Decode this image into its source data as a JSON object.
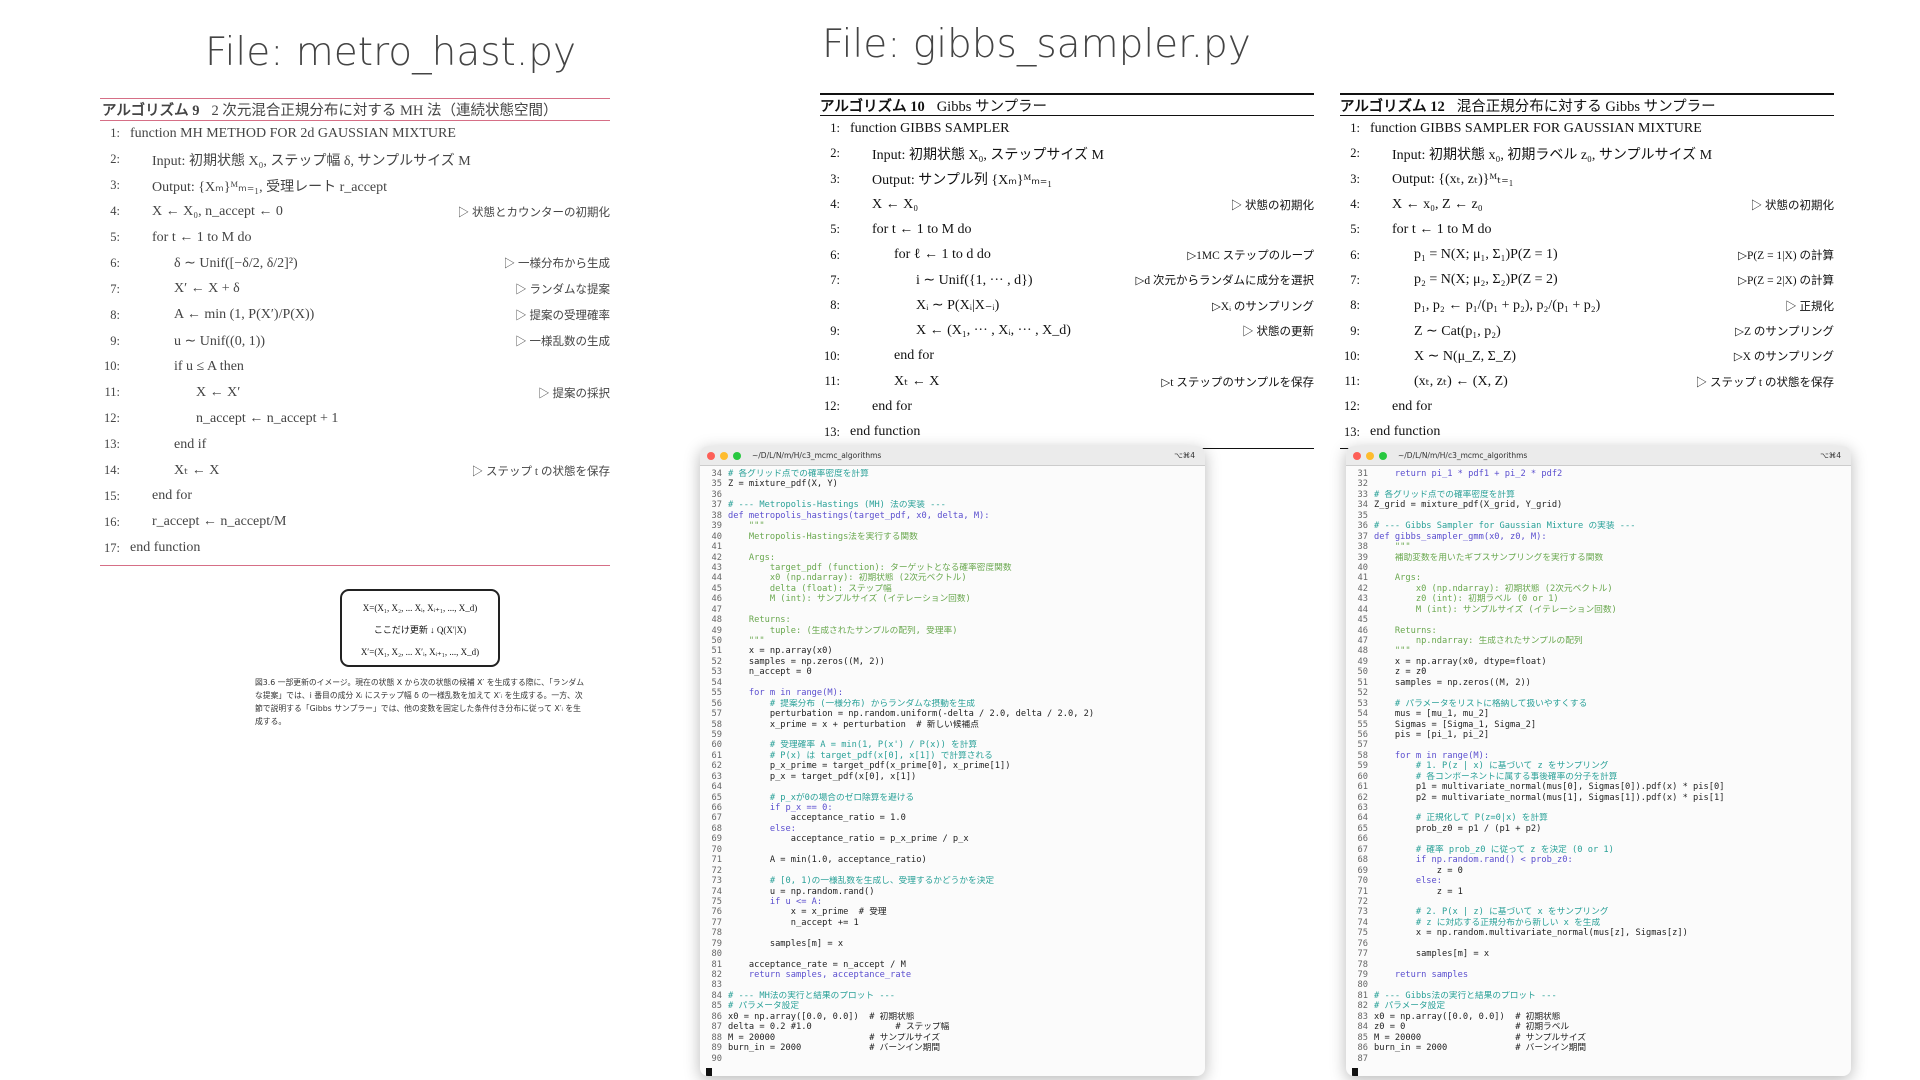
{
  "titles": {
    "left": "File: metro_hast.py",
    "right": "File: gibbs_sampler.py"
  },
  "alg9": {
    "heading": "アルゴリズム 9",
    "title": "2 次元混合正規分布に対する MH 法（連続状態空間）",
    "lines": [
      {
        "n": "1:",
        "t": "function MH METHOD FOR 2d GAUSSIAN MIXTURE",
        "c": ""
      },
      {
        "n": "2:",
        "t": "Input: 初期状態 X₀, ステップ幅 δ, サンプルサイズ M",
        "c": ""
      },
      {
        "n": "3:",
        "t": "Output: {Xₘ}ᴹₘ₌₁, 受理レート r_accept",
        "c": ""
      },
      {
        "n": "4:",
        "t": "X ← X₀, n_accept ← 0",
        "c": "▷ 状態とカウンターの初期化"
      },
      {
        "n": "5:",
        "t": "for t ← 1 to M do",
        "c": ""
      },
      {
        "n": "6:",
        "t": "δ ∼ Unif([−δ/2, δ/2]²)",
        "c": "▷ 一様分布から生成"
      },
      {
        "n": "7:",
        "t": "X′ ← X + δ",
        "c": "▷ ランダムな提案"
      },
      {
        "n": "8:",
        "t": "A ← min (1, P(X′)/P(X))",
        "c": "▷ 提案の受理確率"
      },
      {
        "n": "9:",
        "t": "u ∼ Unif((0, 1))",
        "c": "▷ 一様乱数の生成"
      },
      {
        "n": "10:",
        "t": "if u ≤ A then",
        "c": ""
      },
      {
        "n": "11:",
        "t": "X ← X′",
        "c": "▷ 提案の採択"
      },
      {
        "n": "12:",
        "t": "n_accept ← n_accept + 1",
        "c": ""
      },
      {
        "n": "13:",
        "t": "end if",
        "c": ""
      },
      {
        "n": "14:",
        "t": "Xₜ ← X",
        "c": "▷ ステップ t の状態を保存"
      },
      {
        "n": "15:",
        "t": "end for",
        "c": ""
      },
      {
        "n": "16:",
        "t": "r_accept ← n_accept/M",
        "c": ""
      },
      {
        "n": "17:",
        "t": "end function",
        "c": ""
      }
    ]
  },
  "alg10": {
    "heading": "アルゴリズム 10",
    "title": "Gibbs サンプラー",
    "lines": [
      {
        "n": "1:",
        "t": "function GIBBS SAMPLER",
        "c": ""
      },
      {
        "n": "2:",
        "t": "Input: 初期状態 X₀, ステップサイズ M",
        "c": ""
      },
      {
        "n": "3:",
        "t": "Output: サンプル列 {Xₘ}ᴹₘ₌₁",
        "c": ""
      },
      {
        "n": "4:",
        "t": "X ← X₀",
        "c": "▷ 状態の初期化"
      },
      {
        "n": "5:",
        "t": "for t ← 1 to M do",
        "c": ""
      },
      {
        "n": "6:",
        "t": "for ℓ ← 1 to d do",
        "c": "▷1MC ステップのループ"
      },
      {
        "n": "7:",
        "t": "i ∼ Unif({1, ··· , d})",
        "c": "▷d 次元からランダムに成分を選択"
      },
      {
        "n": "8:",
        "t": "Xᵢ ∼ P(Xᵢ|X₋ᵢ)",
        "c": "▷Xᵢ のサンプリング"
      },
      {
        "n": "9:",
        "t": "X ← (X₁, ··· , Xᵢ, ··· , X_d)",
        "c": "▷ 状態の更新"
      },
      {
        "n": "10:",
        "t": "end for",
        "c": ""
      },
      {
        "n": "11:",
        "t": "Xₜ ← X",
        "c": "▷t ステップのサンプルを保存"
      },
      {
        "n": "12:",
        "t": "end for",
        "c": ""
      },
      {
        "n": "13:",
        "t": "end function",
        "c": ""
      }
    ]
  },
  "alg12": {
    "heading": "アルゴリズム 12",
    "title": "混合正規分布に対する Gibbs サンプラー",
    "lines": [
      {
        "n": "1:",
        "t": "function GIBBS SAMPLER FOR GAUSSIAN MIXTURE",
        "c": ""
      },
      {
        "n": "2:",
        "t": "Input: 初期状態 x₀, 初期ラベル z₀, サンプルサイズ M",
        "c": ""
      },
      {
        "n": "3:",
        "t": "Output: {(xₜ, zₜ)}ᴹₜ₌₁",
        "c": ""
      },
      {
        "n": "4:",
        "t": "X ← x₀, Z ← z₀",
        "c": "▷ 状態の初期化"
      },
      {
        "n": "5:",
        "t": "for t ← 1 to M do",
        "c": ""
      },
      {
        "n": "6:",
        "t": "p₁ = N(X; μ₁, Σ₁)P(Z = 1)",
        "c": "▷P(Z = 1|X) の計算"
      },
      {
        "n": "7:",
        "t": "p₂ = N(X; μ₂, Σ₂)P(Z = 2)",
        "c": "▷P(Z = 2|X) の計算"
      },
      {
        "n": "8:",
        "t": "p₁, p₂ ← p₁/(p₁ + p₂), p₂/(p₁ + p₂)",
        "c": "▷ 正規化"
      },
      {
        "n": "9:",
        "t": "Z ∼ Cat(p₁, p₂)",
        "c": "▷Z のサンプリング"
      },
      {
        "n": "10:",
        "t": "X ∼ N(μ_Z, Σ_Z)",
        "c": "▷X のサンプリング"
      },
      {
        "n": "11:",
        "t": "(xₜ, zₜ) ← (X, Z)",
        "c": "▷ ステップ t の状態を保存"
      },
      {
        "n": "12:",
        "t": "end for",
        "c": ""
      },
      {
        "n": "13:",
        "t": "end function",
        "c": ""
      }
    ]
  },
  "figure": {
    "row1": "X=(X₁, X₂, ... Xᵢ, Xᵢ₊₁, ..., X_d)",
    "mid": "ここだけ更新",
    "q": "Q(X′|X)",
    "row2": "X′=(X₁, X₂, ... X′ᵢ, Xᵢ₊₁, ..., X_d)",
    "caption": "図3.6  一部更新のイメージ。現在の状態 X から次の状態の候補 X′ を生成する際に、「ランダムな提案」では、i 番目の成分 Xᵢ にステップ幅 δ の一様乱数を加えて X′ᵢ を生成する。一方、次節で説明する「Gibbs サンプラー」では、他の変数を固定した条件付き分布に従って X′ᵢ を生成する。"
  },
  "term1": {
    "path": "~/D/L/N/m/H/c3_mcmc_algorithms",
    "shortcut": "⌥⌘4",
    "lines": [
      {
        "n": "34",
        "t": "# 各グリッド点での確率密度を計算",
        "col": "#2aa198"
      },
      {
        "n": "35",
        "t": "Z = mixture_pdf(X, Y)",
        "col": "#222"
      },
      {
        "n": "36",
        "t": "",
        "col": "#222"
      },
      {
        "n": "37",
        "t": "# --- Metropolis-Hastings (MH) 法の実装 ---",
        "col": "#2aa198"
      },
      {
        "n": "38",
        "t": "def metropolis_hastings(target_pdf, x0, delta, M):",
        "col": "#5b4fcf"
      },
      {
        "n": "39",
        "t": "    \"\"\"",
        "col": "#6aa84f"
      },
      {
        "n": "40",
        "t": "    Metropolis-Hastings法を実行する関数",
        "col": "#6aa84f"
      },
      {
        "n": "41",
        "t": "",
        "col": "#222"
      },
      {
        "n": "42",
        "t": "    Args:",
        "col": "#6aa84f"
      },
      {
        "n": "43",
        "t": "        target_pdf (function): ターゲットとなる確率密度関数",
        "col": "#6aa84f"
      },
      {
        "n": "44",
        "t": "        x0 (np.ndarray): 初期状態 (2次元ベクトル)",
        "col": "#6aa84f"
      },
      {
        "n": "45",
        "t": "        delta (float): ステップ幅",
        "col": "#6aa84f"
      },
      {
        "n": "46",
        "t": "        M (int): サンプルサイズ (イテレーション回数)",
        "col": "#6aa84f"
      },
      {
        "n": "47",
        "t": "",
        "col": "#222"
      },
      {
        "n": "48",
        "t": "    Returns:",
        "col": "#6aa84f"
      },
      {
        "n": "49",
        "t": "        tuple: (生成されたサンプルの配列, 受理率)",
        "col": "#6aa84f"
      },
      {
        "n": "50",
        "t": "    \"\"\"",
        "col": "#6aa84f"
      },
      {
        "n": "51",
        "t": "    x = np.array(x0)",
        "col": "#222"
      },
      {
        "n": "52",
        "t": "    samples = np.zeros((M, 2))",
        "col": "#222"
      },
      {
        "n": "53",
        "t": "    n_accept = 0",
        "col": "#222"
      },
      {
        "n": "54",
        "t": "",
        "col": "#222"
      },
      {
        "n": "55",
        "t": "    for m in range(M):",
        "col": "#5b4fcf"
      },
      {
        "n": "56",
        "t": "        # 提案分布 (一様分布) からランダムな摂動を生成",
        "col": "#2aa198"
      },
      {
        "n": "57",
        "t": "        perturbation = np.random.uniform(-delta / 2.0, delta / 2.0, 2)",
        "col": "#222"
      },
      {
        "n": "58",
        "t": "        x_prime = x + perturbation  # 新しい候補点",
        "col": "#222"
      },
      {
        "n": "59",
        "t": "",
        "col": "#222"
      },
      {
        "n": "60",
        "t": "        # 受理確率 A = min(1, P(x') / P(x)) を計算",
        "col": "#2aa198"
      },
      {
        "n": "61",
        "t": "        # P(x) は target_pdf(x[0], x[1]) で計算される",
        "col": "#2aa198"
      },
      {
        "n": "62",
        "t": "        p_x_prime = target_pdf(x_prime[0], x_prime[1])",
        "col": "#222"
      },
      {
        "n": "63",
        "t": "        p_x = target_pdf(x[0], x[1])",
        "col": "#222"
      },
      {
        "n": "64",
        "t": "",
        "col": "#222"
      },
      {
        "n": "65",
        "t": "        # p_xが0の場合のゼロ除算を避ける",
        "col": "#2aa198"
      },
      {
        "n": "66",
        "t": "        if p_x == 0:",
        "col": "#5b4fcf"
      },
      {
        "n": "67",
        "t": "            acceptance_ratio = 1.0",
        "col": "#222"
      },
      {
        "n": "68",
        "t": "        else:",
        "col": "#5b4fcf"
      },
      {
        "n": "69",
        "t": "            acceptance_ratio = p_x_prime / p_x",
        "col": "#222"
      },
      {
        "n": "70",
        "t": "",
        "col": "#222"
      },
      {
        "n": "71",
        "t": "        A = min(1.0, acceptance_ratio)",
        "col": "#222"
      },
      {
        "n": "72",
        "t": "",
        "col": "#222"
      },
      {
        "n": "73",
        "t": "        # [0, 1)の一様乱数を生成し、受理するかどうかを決定",
        "col": "#2aa198"
      },
      {
        "n": "74",
        "t": "        u = np.random.rand()",
        "col": "#222"
      },
      {
        "n": "75",
        "t": "        if u <= A:",
        "col": "#5b4fcf"
      },
      {
        "n": "76",
        "t": "            x = x_prime  # 受理",
        "col": "#222"
      },
      {
        "n": "77",
        "t": "            n_accept += 1",
        "col": "#222"
      },
      {
        "n": "78",
        "t": "",
        "col": "#222"
      },
      {
        "n": "79",
        "t": "        samples[m] = x",
        "col": "#222"
      },
      {
        "n": "80",
        "t": "",
        "col": "#222"
      },
      {
        "n": "81",
        "t": "    acceptance_rate = n_accept / M",
        "col": "#222"
      },
      {
        "n": "82",
        "t": "    return samples, acceptance_rate",
        "col": "#5b4fcf"
      },
      {
        "n": "83",
        "t": "",
        "col": "#222"
      },
      {
        "n": "84",
        "t": "# --- MH法の実行と結果のプロット ---",
        "col": "#2aa198"
      },
      {
        "n": "85",
        "t": "# パラメータ設定",
        "col": "#2aa198"
      },
      {
        "n": "86",
        "t": "x0 = np.array([0.0, 0.0])  # 初期状態",
        "col": "#222"
      },
      {
        "n": "87",
        "t": "delta = 0.2 #1.0                # ステップ幅",
        "col": "#222"
      },
      {
        "n": "88",
        "t": "M = 20000                  # サンプルサイズ",
        "col": "#222"
      },
      {
        "n": "89",
        "t": "burn_in = 2000             # バーンイン期間",
        "col": "#222"
      },
      {
        "n": "90",
        "t": "",
        "col": "#222"
      }
    ]
  },
  "term2": {
    "path": "~/D/L/N/m/H/c3_mcmc_algorithms",
    "shortcut": "⌥⌘4",
    "lines": [
      {
        "n": "31",
        "t": "    return pi_1 * pdf1 + pi_2 * pdf2",
        "col": "#5b4fcf"
      },
      {
        "n": "32",
        "t": "",
        "col": "#222"
      },
      {
        "n": "33",
        "t": "# 各グリッド点での確率密度を計算",
        "col": "#2aa198"
      },
      {
        "n": "34",
        "t": "Z_grid = mixture_pdf(X_grid, Y_grid)",
        "col": "#222"
      },
      {
        "n": "35",
        "t": "",
        "col": "#222"
      },
      {
        "n": "36",
        "t": "# --- Gibbs Sampler for Gaussian Mixture の実装 ---",
        "col": "#2aa198"
      },
      {
        "n": "37",
        "t": "def gibbs_sampler_gmm(x0, z0, M):",
        "col": "#5b4fcf"
      },
      {
        "n": "38",
        "t": "    \"\"\"",
        "col": "#6aa84f"
      },
      {
        "n": "39",
        "t": "    補助変数を用いたギブスサンプリングを実行する関数",
        "col": "#6aa84f"
      },
      {
        "n": "40",
        "t": "",
        "col": "#222"
      },
      {
        "n": "41",
        "t": "    Args:",
        "col": "#6aa84f"
      },
      {
        "n": "42",
        "t": "        x0 (np.ndarray): 初期状態 (2次元ベクトル)",
        "col": "#6aa84f"
      },
      {
        "n": "43",
        "t": "        z0 (int): 初期ラベル (0 or 1)",
        "col": "#6aa84f"
      },
      {
        "n": "44",
        "t": "        M (int): サンプルサイズ (イテレーション回数)",
        "col": "#6aa84f"
      },
      {
        "n": "45",
        "t": "",
        "col": "#222"
      },
      {
        "n": "46",
        "t": "    Returns:",
        "col": "#6aa84f"
      },
      {
        "n": "47",
        "t": "        np.ndarray: 生成されたサンプルの配列",
        "col": "#6aa84f"
      },
      {
        "n": "48",
        "t": "    \"\"\"",
        "col": "#6aa84f"
      },
      {
        "n": "49",
        "t": "    x = np.array(x0, dtype=float)",
        "col": "#222"
      },
      {
        "n": "50",
        "t": "    z = z0",
        "col": "#222"
      },
      {
        "n": "51",
        "t": "    samples = np.zeros((M, 2))",
        "col": "#222"
      },
      {
        "n": "52",
        "t": "",
        "col": "#222"
      },
      {
        "n": "53",
        "t": "    # パラメータをリストに格納して扱いやすくする",
        "col": "#2aa198"
      },
      {
        "n": "54",
        "t": "    mus = [mu_1, mu_2]",
        "col": "#222"
      },
      {
        "n": "55",
        "t": "    Sigmas = [Sigma_1, Sigma_2]",
        "col": "#222"
      },
      {
        "n": "56",
        "t": "    pis = [pi_1, pi_2]",
        "col": "#222"
      },
      {
        "n": "57",
        "t": "",
        "col": "#222"
      },
      {
        "n": "58",
        "t": "    for m in range(M):",
        "col": "#5b4fcf"
      },
      {
        "n": "59",
        "t": "        # 1. P(z | x) に基づいて z をサンプリング",
        "col": "#2aa198"
      },
      {
        "n": "60",
        "t": "        # 各コンポーネントに属する事後確率の分子を計算",
        "col": "#2aa198"
      },
      {
        "n": "61",
        "t": "        p1 = multivariate_normal(mus[0], Sigmas[0]).pdf(x) * pis[0]",
        "col": "#222"
      },
      {
        "n": "62",
        "t": "        p2 = multivariate_normal(mus[1], Sigmas[1]).pdf(x) * pis[1]",
        "col": "#222"
      },
      {
        "n": "63",
        "t": "",
        "col": "#222"
      },
      {
        "n": "64",
        "t": "        # 正規化して P(z=0|x) を計算",
        "col": "#2aa198"
      },
      {
        "n": "65",
        "t": "        prob_z0 = p1 / (p1 + p2)",
        "col": "#222"
      },
      {
        "n": "66",
        "t": "",
        "col": "#222"
      },
      {
        "n": "67",
        "t": "        # 確率 prob_z0 に従って z を決定 (0 or 1)",
        "col": "#2aa198"
      },
      {
        "n": "68",
        "t": "        if np.random.rand() < prob_z0:",
        "col": "#5b4fcf"
      },
      {
        "n": "69",
        "t": "            z = 0",
        "col": "#222"
      },
      {
        "n": "70",
        "t": "        else:",
        "col": "#5b4fcf"
      },
      {
        "n": "71",
        "t": "            z = 1",
        "col": "#222"
      },
      {
        "n": "72",
        "t": "",
        "col": "#222"
      },
      {
        "n": "73",
        "t": "        # 2. P(x | z) に基づいて x をサンプリング",
        "col": "#2aa198"
      },
      {
        "n": "74",
        "t": "        # z に対応する正規分布から新しい x を生成",
        "col": "#2aa198"
      },
      {
        "n": "75",
        "t": "        x = np.random.multivariate_normal(mus[z], Sigmas[z])",
        "col": "#222"
      },
      {
        "n": "76",
        "t": "",
        "col": "#222"
      },
      {
        "n": "77",
        "t": "        samples[m] = x",
        "col": "#222"
      },
      {
        "n": "78",
        "t": "",
        "col": "#222"
      },
      {
        "n": "79",
        "t": "    return samples",
        "col": "#5b4fcf"
      },
      {
        "n": "80",
        "t": "",
        "col": "#222"
      },
      {
        "n": "81",
        "t": "# --- Gibbs法の実行と結果のプロット ---",
        "col": "#2aa198"
      },
      {
        "n": "82",
        "t": "# パラメータ設定",
        "col": "#2aa198"
      },
      {
        "n": "83",
        "t": "x0 = np.array([0.0, 0.0])  # 初期状態",
        "col": "#222"
      },
      {
        "n": "84",
        "t": "z0 = 0                     # 初期ラベル",
        "col": "#222"
      },
      {
        "n": "85",
        "t": "M = 20000                  # サンプルサイズ",
        "col": "#222"
      },
      {
        "n": "86",
        "t": "burn_in = 2000             # バーンイン期間",
        "col": "#222"
      },
      {
        "n": "87",
        "t": "",
        "col": "#222"
      }
    ]
  }
}
